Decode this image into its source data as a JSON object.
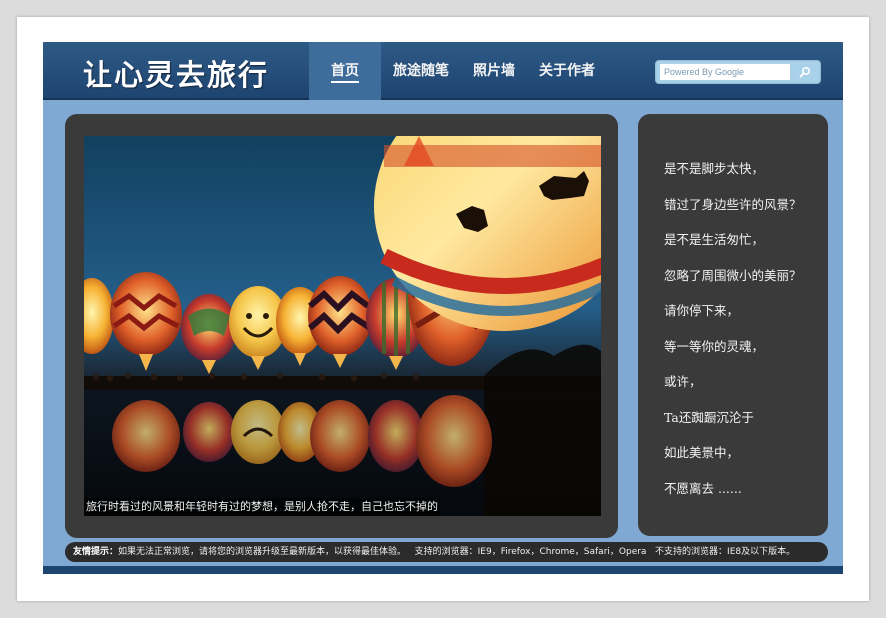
{
  "header": {
    "logo": "让心灵去旅行",
    "nav": [
      {
        "label": "首页",
        "active": true
      },
      {
        "label": "旅途随笔",
        "active": false
      },
      {
        "label": "照片墙",
        "active": false
      },
      {
        "label": "关于作者",
        "active": false
      }
    ],
    "search": {
      "placeholder": "Powered By Google",
      "icon": "search-icon"
    }
  },
  "photo": {
    "caption": "旅行时看过的风景和年轻时有过的梦想，是别人抢不走，自己也忘不掉的"
  },
  "poem": [
    "是不是脚步太快，",
    "错过了身边些许的风景？",
    "是不是生活匆忙，",
    "忽略了周围微小的美丽？",
    "请你停下来，",
    "等一等你的灵魂，",
    "或许，",
    "Ta还踟蹰沉沦于",
    "如此美景中，",
    "不愿离去 ......"
  ],
  "footer": {
    "tip_label": "友情提示：",
    "tip_text": "如果无法正常浏览，请将您的浏览器升级至最新版本，以获得最佳体验。",
    "supported": "支持的浏览器：IE9，Firefox，Chrome，Safari，Opera",
    "unsupported": "不支持的浏览器：IE8及以下版本。"
  },
  "colors": {
    "header": "#1e4470",
    "nav_active": "#3e6d9c",
    "page_bg": "#7fa9d3",
    "panel_bg": "#3a3a3a"
  }
}
